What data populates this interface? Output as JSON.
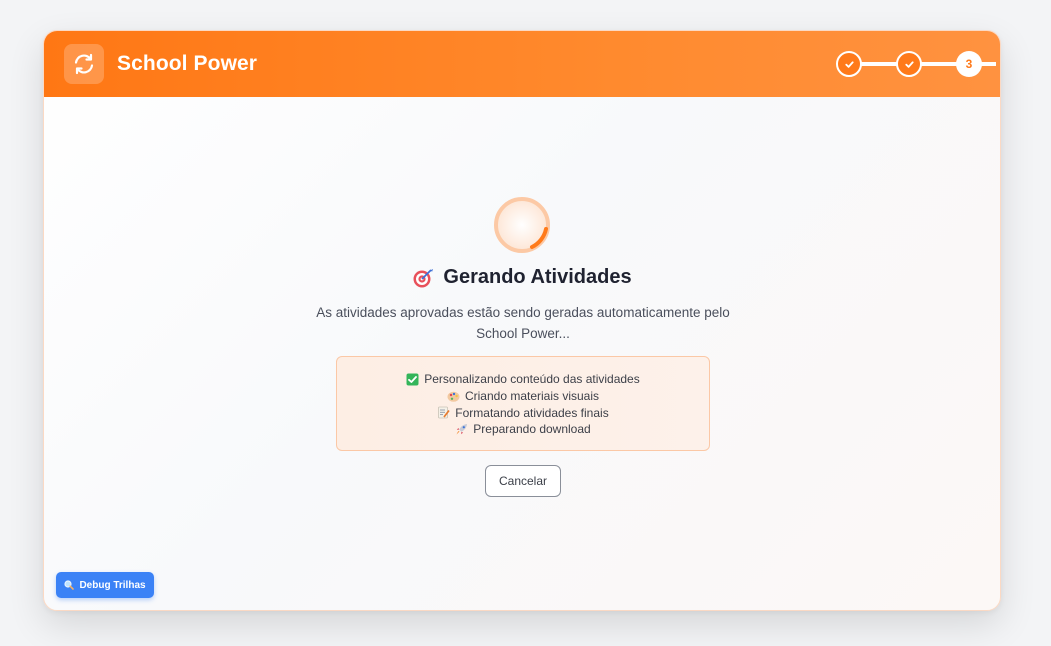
{
  "header": {
    "app_title": "School Power",
    "logo_icon": "refresh-icon",
    "steps": [
      {
        "state": "done",
        "icon": "check-icon"
      },
      {
        "state": "done",
        "icon": "check-icon"
      },
      {
        "state": "current",
        "label": "3"
      }
    ]
  },
  "main": {
    "title_emoji": "target-icon",
    "title": "Gerando Atividades",
    "description": "As atividades aprovadas estão sendo geradas automaticamente pelo School Power...",
    "status_items": [
      {
        "icon": "check-box-icon",
        "label": "Personalizando conteúdo das atividades"
      },
      {
        "icon": "palette-icon",
        "label": "Criando materiais visuais"
      },
      {
        "icon": "memo-icon",
        "label": "Formatando atividades finais"
      },
      {
        "icon": "rocket-icon",
        "label": "Preparando download"
      }
    ],
    "cancel_label": "Cancelar"
  },
  "debug": {
    "icon": "magnifier-icon",
    "label": "Debug Trilhas"
  },
  "colors": {
    "accent": "#ff7a1a",
    "debug_button": "#3b82f6"
  }
}
